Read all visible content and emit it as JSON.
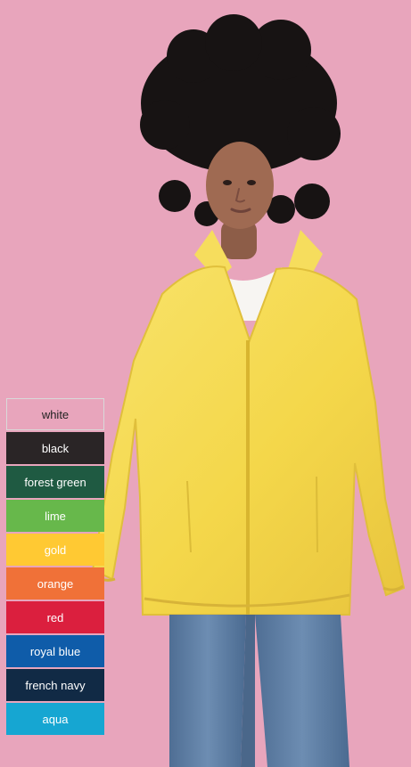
{
  "colors": {
    "background": "#e8a5bc",
    "jacket": "#f4d74a",
    "jeans": "#5f7ea3",
    "skin": "#9f6a52",
    "hair": "#171313"
  },
  "product_image": {
    "subject": "woman-wearing-yellow-jacket"
  },
  "color_options": [
    {
      "name": "white",
      "hex": "#ffffff"
    },
    {
      "name": "black",
      "hex": "#2a2526"
    },
    {
      "name": "forest green",
      "hex": "#1f5a42"
    },
    {
      "name": "lime",
      "hex": "#67b84b"
    },
    {
      "name": "gold",
      "hex": "#ffc933"
    },
    {
      "name": "orange",
      "hex": "#f07138"
    },
    {
      "name": "red",
      "hex": "#db1f3e"
    },
    {
      "name": "royal blue",
      "hex": "#0f5ca9"
    },
    {
      "name": "french navy",
      "hex": "#112a45"
    },
    {
      "name": "aqua",
      "hex": "#16a6d2"
    }
  ]
}
